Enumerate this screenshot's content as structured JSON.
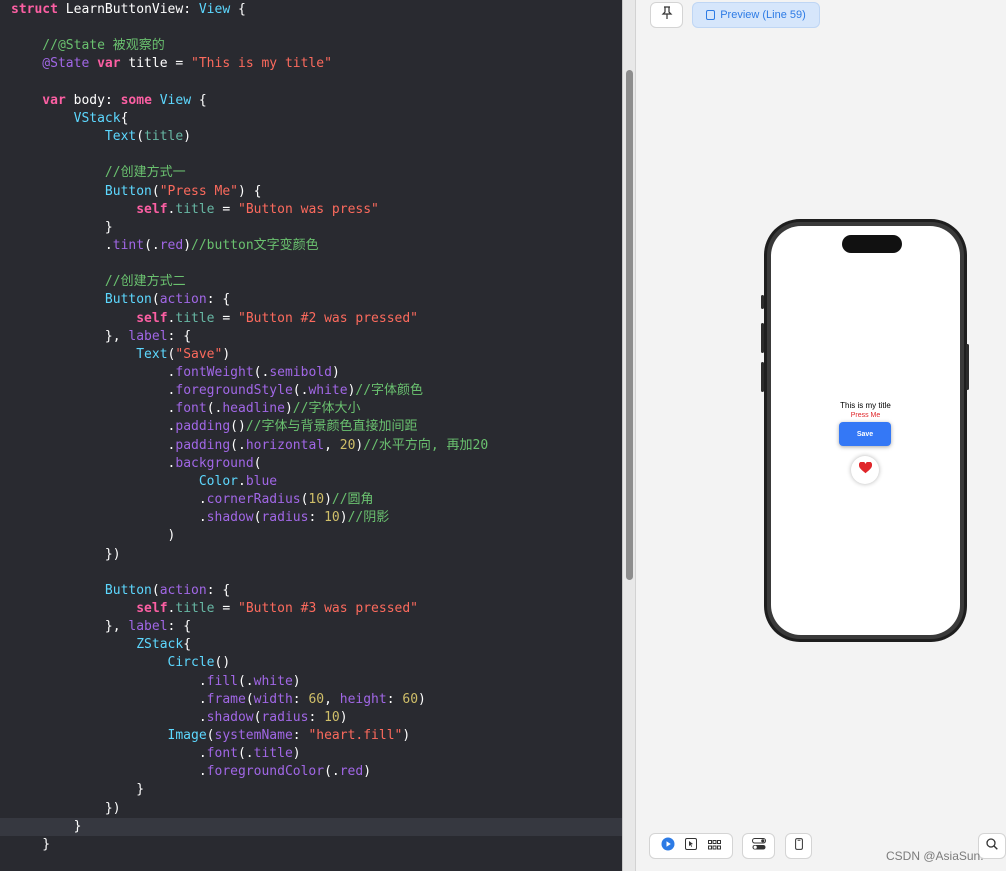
{
  "editor": {
    "lines": [
      [
        {
          "c": "k",
          "t": "struct "
        },
        {
          "c": "pl",
          "t": "LearnButtonView"
        },
        {
          "c": "pl",
          "t": ": "
        },
        {
          "c": "t",
          "t": "View"
        },
        {
          "c": "pl",
          "t": " {"
        }
      ],
      [],
      [
        {
          "c": "c",
          "t": "    //@State 被观察的"
        }
      ],
      [
        {
          "c": "f",
          "t": "    @State "
        },
        {
          "c": "k",
          "t": "var "
        },
        {
          "c": "pl",
          "t": "title"
        },
        {
          "c": "pl",
          "t": " = "
        },
        {
          "c": "s",
          "t": "\"This is my title\""
        }
      ],
      [],
      [
        {
          "c": "k",
          "t": "    var "
        },
        {
          "c": "pl",
          "t": "body"
        },
        {
          "c": "pl",
          "t": ": "
        },
        {
          "c": "k",
          "t": "some "
        },
        {
          "c": "t",
          "t": "View"
        },
        {
          "c": "pl",
          "t": " {"
        }
      ],
      [
        {
          "c": "t",
          "t": "        VStack"
        },
        {
          "c": "pl",
          "t": "{"
        }
      ],
      [
        {
          "c": "t",
          "t": "            Text"
        },
        {
          "c": "pl",
          "t": "("
        },
        {
          "c": "p",
          "t": "title"
        },
        {
          "c": "pl",
          "t": ")"
        }
      ],
      [],
      [
        {
          "c": "c",
          "t": "            //创建方式一"
        }
      ],
      [
        {
          "c": "t",
          "t": "            Button"
        },
        {
          "c": "pl",
          "t": "("
        },
        {
          "c": "s",
          "t": "\"Press Me\""
        },
        {
          "c": "pl",
          "t": ") {"
        }
      ],
      [
        {
          "c": "k",
          "t": "                self"
        },
        {
          "c": "pl",
          "t": "."
        },
        {
          "c": "p",
          "t": "title"
        },
        {
          "c": "pl",
          "t": " = "
        },
        {
          "c": "s",
          "t": "\"Button was press\""
        }
      ],
      [
        {
          "c": "pl",
          "t": "            }"
        }
      ],
      [
        {
          "c": "pl",
          "t": "            ."
        },
        {
          "c": "f",
          "t": "tint"
        },
        {
          "c": "pl",
          "t": "(."
        },
        {
          "c": "f",
          "t": "red"
        },
        {
          "c": "pl",
          "t": ")"
        },
        {
          "c": "c",
          "t": "//button文字变颜色"
        }
      ],
      [],
      [
        {
          "c": "c",
          "t": "            //创建方式二"
        }
      ],
      [
        {
          "c": "t",
          "t": "            Button"
        },
        {
          "c": "pl",
          "t": "("
        },
        {
          "c": "lbl",
          "t": "action"
        },
        {
          "c": "pl",
          "t": ": {"
        }
      ],
      [
        {
          "c": "k",
          "t": "                self"
        },
        {
          "c": "pl",
          "t": "."
        },
        {
          "c": "p",
          "t": "title"
        },
        {
          "c": "pl",
          "t": " = "
        },
        {
          "c": "s",
          "t": "\"Button #2 was pressed\""
        }
      ],
      [
        {
          "c": "pl",
          "t": "            }, "
        },
        {
          "c": "lbl",
          "t": "label"
        },
        {
          "c": "pl",
          "t": ": {"
        }
      ],
      [
        {
          "c": "t",
          "t": "                Text"
        },
        {
          "c": "pl",
          "t": "("
        },
        {
          "c": "s",
          "t": "\"Save\""
        },
        {
          "c": "pl",
          "t": ")"
        }
      ],
      [
        {
          "c": "pl",
          "t": "                    ."
        },
        {
          "c": "f",
          "t": "fontWeight"
        },
        {
          "c": "pl",
          "t": "(."
        },
        {
          "c": "f",
          "t": "semibold"
        },
        {
          "c": "pl",
          "t": ")"
        }
      ],
      [
        {
          "c": "pl",
          "t": "                    ."
        },
        {
          "c": "f",
          "t": "foregroundStyle"
        },
        {
          "c": "pl",
          "t": "(."
        },
        {
          "c": "f",
          "t": "white"
        },
        {
          "c": "pl",
          "t": ")"
        },
        {
          "c": "c",
          "t": "//字体颜色"
        }
      ],
      [
        {
          "c": "pl",
          "t": "                    ."
        },
        {
          "c": "f",
          "t": "font"
        },
        {
          "c": "pl",
          "t": "(."
        },
        {
          "c": "f",
          "t": "headline"
        },
        {
          "c": "pl",
          "t": ")"
        },
        {
          "c": "c",
          "t": "//字体大小"
        }
      ],
      [
        {
          "c": "pl",
          "t": "                    ."
        },
        {
          "c": "f",
          "t": "padding"
        },
        {
          "c": "pl",
          "t": "()"
        },
        {
          "c": "c",
          "t": "//字体与背景颜色直接加间距"
        }
      ],
      [
        {
          "c": "pl",
          "t": "                    ."
        },
        {
          "c": "f",
          "t": "padding"
        },
        {
          "c": "pl",
          "t": "(."
        },
        {
          "c": "f",
          "t": "horizontal"
        },
        {
          "c": "pl",
          "t": ", "
        },
        {
          "c": "n",
          "t": "20"
        },
        {
          "c": "pl",
          "t": ")"
        },
        {
          "c": "c",
          "t": "//水平方向, 再加20"
        }
      ],
      [
        {
          "c": "pl",
          "t": "                    ."
        },
        {
          "c": "f",
          "t": "background"
        },
        {
          "c": "pl",
          "t": "("
        }
      ],
      [
        {
          "c": "t",
          "t": "                        Color"
        },
        {
          "c": "pl",
          "t": "."
        },
        {
          "c": "f",
          "t": "blue"
        }
      ],
      [
        {
          "c": "pl",
          "t": "                        ."
        },
        {
          "c": "f",
          "t": "cornerRadius"
        },
        {
          "c": "pl",
          "t": "("
        },
        {
          "c": "n",
          "t": "10"
        },
        {
          "c": "pl",
          "t": ")"
        },
        {
          "c": "c",
          "t": "//圆角"
        }
      ],
      [
        {
          "c": "pl",
          "t": "                        ."
        },
        {
          "c": "f",
          "t": "shadow"
        },
        {
          "c": "pl",
          "t": "("
        },
        {
          "c": "lbl",
          "t": "radius"
        },
        {
          "c": "pl",
          "t": ": "
        },
        {
          "c": "n",
          "t": "10"
        },
        {
          "c": "pl",
          "t": ")"
        },
        {
          "c": "c",
          "t": "//阴影"
        }
      ],
      [
        {
          "c": "pl",
          "t": "                    )"
        }
      ],
      [
        {
          "c": "pl",
          "t": "            })"
        }
      ],
      [],
      [
        {
          "c": "t",
          "t": "            Button"
        },
        {
          "c": "pl",
          "t": "("
        },
        {
          "c": "lbl",
          "t": "action"
        },
        {
          "c": "pl",
          "t": ": {"
        }
      ],
      [
        {
          "c": "k",
          "t": "                self"
        },
        {
          "c": "pl",
          "t": "."
        },
        {
          "c": "p",
          "t": "title"
        },
        {
          "c": "pl",
          "t": " = "
        },
        {
          "c": "s",
          "t": "\"Button #3 was pressed\""
        }
      ],
      [
        {
          "c": "pl",
          "t": "            }, "
        },
        {
          "c": "lbl",
          "t": "label"
        },
        {
          "c": "pl",
          "t": ": {"
        }
      ],
      [
        {
          "c": "t",
          "t": "                ZStack"
        },
        {
          "c": "pl",
          "t": "{"
        }
      ],
      [
        {
          "c": "t",
          "t": "                    Circle"
        },
        {
          "c": "pl",
          "t": "()"
        }
      ],
      [
        {
          "c": "pl",
          "t": "                        ."
        },
        {
          "c": "f",
          "t": "fill"
        },
        {
          "c": "pl",
          "t": "(."
        },
        {
          "c": "f",
          "t": "white"
        },
        {
          "c": "pl",
          "t": ")"
        }
      ],
      [
        {
          "c": "pl",
          "t": "                        ."
        },
        {
          "c": "f",
          "t": "frame"
        },
        {
          "c": "pl",
          "t": "("
        },
        {
          "c": "lbl",
          "t": "width"
        },
        {
          "c": "pl",
          "t": ": "
        },
        {
          "c": "n",
          "t": "60"
        },
        {
          "c": "pl",
          "t": ", "
        },
        {
          "c": "lbl",
          "t": "height"
        },
        {
          "c": "pl",
          "t": ": "
        },
        {
          "c": "n",
          "t": "60"
        },
        {
          "c": "pl",
          "t": ")"
        }
      ],
      [
        {
          "c": "pl",
          "t": "                        ."
        },
        {
          "c": "f",
          "t": "shadow"
        },
        {
          "c": "pl",
          "t": "("
        },
        {
          "c": "lbl",
          "t": "radius"
        },
        {
          "c": "pl",
          "t": ": "
        },
        {
          "c": "n",
          "t": "10"
        },
        {
          "c": "pl",
          "t": ")"
        }
      ],
      [
        {
          "c": "t",
          "t": "                    Image"
        },
        {
          "c": "pl",
          "t": "("
        },
        {
          "c": "lbl",
          "t": "systemName"
        },
        {
          "c": "pl",
          "t": ": "
        },
        {
          "c": "s",
          "t": "\"heart.fill\""
        },
        {
          "c": "pl",
          "t": ")"
        }
      ],
      [
        {
          "c": "pl",
          "t": "                        ."
        },
        {
          "c": "f",
          "t": "font"
        },
        {
          "c": "pl",
          "t": "(."
        },
        {
          "c": "f",
          "t": "title"
        },
        {
          "c": "pl",
          "t": ")"
        }
      ],
      [
        {
          "c": "pl",
          "t": "                        ."
        },
        {
          "c": "f",
          "t": "foregroundColor"
        },
        {
          "c": "pl",
          "t": "(."
        },
        {
          "c": "f",
          "t": "red"
        },
        {
          "c": "pl",
          "t": ")"
        }
      ],
      [
        {
          "c": "pl",
          "t": "                }"
        }
      ],
      [
        {
          "c": "pl",
          "t": "            })"
        }
      ],
      [
        {
          "c": "pl",
          "t": "        }"
        }
      ],
      [
        {
          "c": "pl",
          "t": "    }"
        }
      ]
    ],
    "current_line_index": 45,
    "colors": {
      "background": "#292a30",
      "current_line": "#363840"
    }
  },
  "preview": {
    "pin_icon": "pin-icon",
    "preview_label": "Preview (Line 59)",
    "screen": {
      "title_text": "This is my title",
      "press_text": "Press Me",
      "save_text": "Save",
      "heart_icon": "heart-fill-icon",
      "heart_color": "#e0262a",
      "save_color": "#3478f6"
    },
    "toolbar_icons": [
      "live-mode-icon",
      "select-mode-icon",
      "variants-grid-icon",
      "variants-toggle-icon",
      "device-icon",
      "zoom-icon"
    ]
  },
  "watermark": "CSDN @AsiaSun."
}
